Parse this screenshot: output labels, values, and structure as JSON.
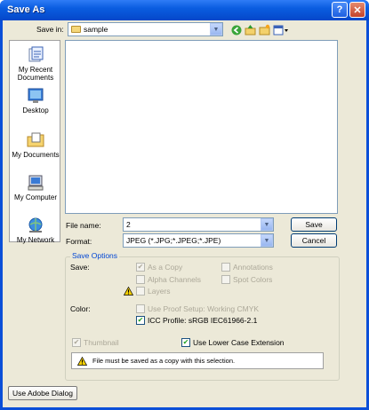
{
  "window": {
    "title": "Save As",
    "help_glyph": "?",
    "close_glyph": "✕"
  },
  "toolbar": {
    "save_in_label": "Save in:",
    "save_in_value": "sample",
    "icons": [
      "back-icon",
      "up-folder-icon",
      "new-folder-icon",
      "view-menu-icon"
    ]
  },
  "places": [
    {
      "label": "My Recent Documents",
      "icon": "recent-documents-icon"
    },
    {
      "label": "Desktop",
      "icon": "desktop-icon"
    },
    {
      "label": "My Documents",
      "icon": "my-documents-icon"
    },
    {
      "label": "My Computer",
      "icon": "my-computer-icon"
    },
    {
      "label": "My Network",
      "icon": "my-network-icon"
    }
  ],
  "file": {
    "name_label": "File name:",
    "name_value": "2",
    "format_label": "Format:",
    "format_value": "JPEG (*.JPG;*.JPEG;*.JPE)"
  },
  "buttons": {
    "save": "Save",
    "cancel": "Cancel",
    "adobe_dialog": "Use Adobe Dialog"
  },
  "save_options": {
    "title": "Save Options",
    "save_label": "Save:",
    "as_copy": "As a Copy",
    "alpha_channels": "Alpha Channels",
    "layers": "Layers",
    "annotations": "Annotations",
    "spot_colors": "Spot Colors",
    "color_label": "Color:",
    "proof_setup": "Use Proof Setup:  Working CMYK",
    "icc_profile": "ICC Profile:  sRGB IEC61966-2.1",
    "thumbnail": "Thumbnail",
    "lower_case": "Use Lower Case Extension",
    "notice": "File must be saved as a copy with this selection."
  }
}
